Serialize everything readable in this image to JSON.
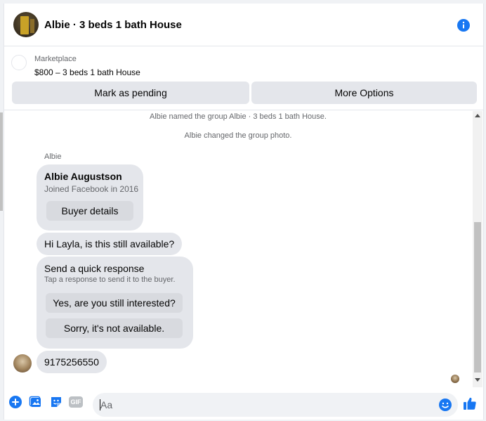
{
  "header": {
    "title": "Albie · 3 beds 1 bath House",
    "accent": "#1877f2"
  },
  "marketplace": {
    "label": "Marketplace",
    "item": "$800 – 3 beds 1 bath House",
    "pending_button": "Mark as pending",
    "more_button": "More Options"
  },
  "conversation": {
    "system_messages": [
      "Albie named the group Albie · 3 beds 1 bath House.",
      "Albie changed the group photo."
    ],
    "sender_name": "Albie",
    "buyer_card": {
      "name": "Albie Augustson",
      "joined": "Joined Facebook in 2016",
      "details_button": "Buyer details"
    },
    "message_hi": "Hi Layla, is this still available?",
    "quick_response": {
      "title": "Send a quick response",
      "subtitle": "Tap a response to send it to the buyer.",
      "options": [
        "Yes, are you still interested?",
        "Sorry, it's not available."
      ]
    },
    "message_phone": "9175256550"
  },
  "composer": {
    "placeholder": "Aa",
    "icons": [
      "plus-icon",
      "photo-icon",
      "sticker-icon",
      "gif-icon",
      "emoji-icon",
      "like-icon"
    ],
    "gif_label": "GIF"
  }
}
